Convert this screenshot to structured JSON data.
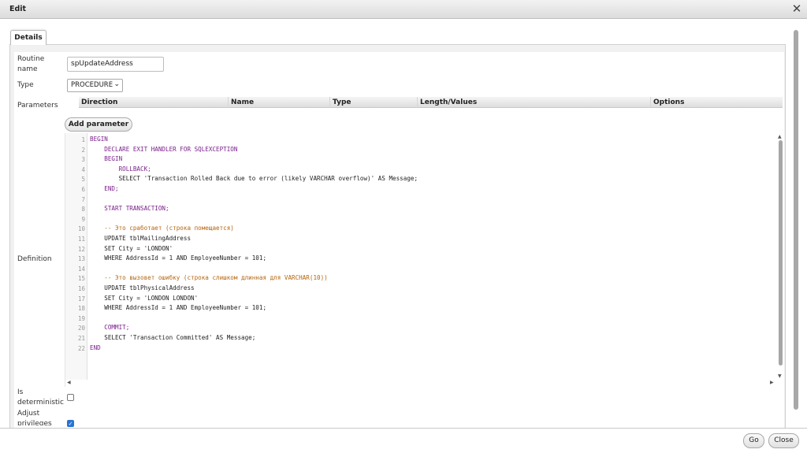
{
  "dialog": {
    "title": "Edit",
    "close_glyph": "✕"
  },
  "tab": {
    "label": "Details"
  },
  "form": {
    "routine_name_label": "Routine name",
    "routine_name_value": "spUpdateAddress",
    "type_label": "Type",
    "type_value": "PROCEDURE",
    "parameters_label": "Parameters",
    "param_columns": [
      "Direction",
      "Name",
      "Type",
      "Length/Values",
      "Options"
    ],
    "add_parameter_label": "Add parameter",
    "definition_label": "Definition",
    "is_deterministic_label": "Is deterministic",
    "is_deterministic_checked": false,
    "adjust_privileges_label": "Adjust privileges",
    "adjust_privileges_checked": true
  },
  "code_lines": [
    "BEGIN",
    "    DECLARE EXIT HANDLER FOR SQLEXCEPTION",
    "    BEGIN",
    "        ROLLBACK;",
    "        SELECT 'Transaction Rolled Back due to error (likely VARCHAR overflow)' AS Message;",
    "    END;",
    "",
    "    START TRANSACTION;",
    "",
    "    -- Это сработает (строка помещается)",
    "    UPDATE tblMailingAddress",
    "    SET City = 'LONDON'",
    "    WHERE AddressId = 1 AND EmployeeNumber = 101;",
    "",
    "    -- Это вызовет ошибку (строка слишком длинная для VARCHAR(10))",
    "    UPDATE tblPhysicalAddress",
    "    SET City = 'LONDON LONDON'",
    "    WHERE AddressId = 1 AND EmployeeNumber = 101;",
    "",
    "    COMMIT;",
    "    SELECT 'Transaction Committed' AS Message;",
    "END"
  ],
  "footer": {
    "go_label": "Go",
    "close_label": "Close"
  },
  "icons": [
    "close-icon",
    "chevron-down-icon",
    "scroll-up-icon",
    "scroll-down-icon",
    "scroll-left-icon",
    "scroll-right-icon",
    "check-icon"
  ],
  "colors": {
    "keyword": "#7a1f8a",
    "string": "#a0282d",
    "number": "#117d52",
    "comment": "#b6650f",
    "checkbox_checked": "#2a72d1"
  }
}
